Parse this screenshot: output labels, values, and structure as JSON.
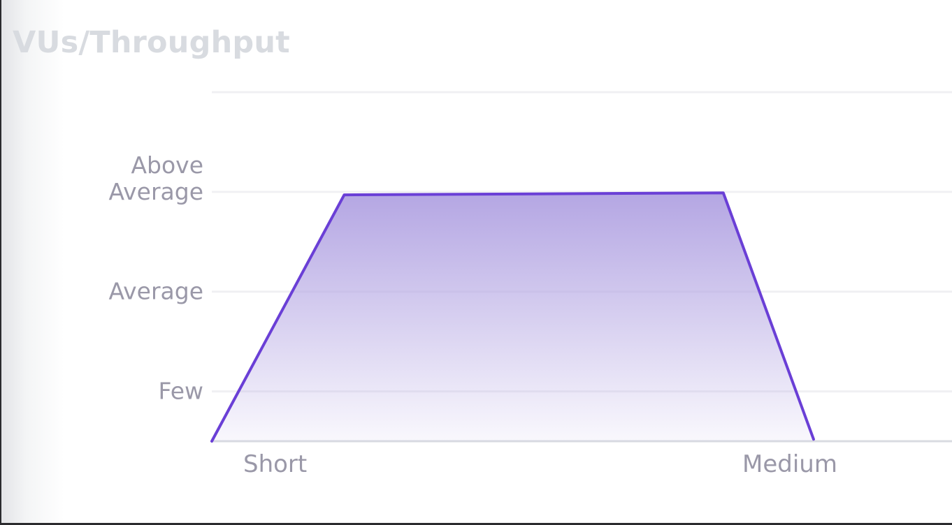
{
  "title": "VUs/Throughput",
  "colors": {
    "line": "#6a3fd6",
    "fill_top": "#b4a6e3",
    "grid": "#f0f0f3",
    "axis": "#d9dbe1",
    "tick_text": "#9a98a8",
    "title": "#d8dbe0"
  },
  "chart_data": {
    "type": "area",
    "title": "VUs/Throughput",
    "xlabel": "",
    "ylabel": "",
    "x_ticks": [
      "Short",
      "Medium"
    ],
    "y_ticks": [
      {
        "value": 1,
        "lines": [
          "Few"
        ]
      },
      {
        "value": 2,
        "lines": [
          "Average"
        ]
      },
      {
        "value": 3,
        "lines": [
          "Above",
          "Average"
        ]
      }
    ],
    "xlim": [
      0,
      1.23
    ],
    "ylim": [
      0.5,
      4
    ],
    "grid": true,
    "series": [
      {
        "x": [
          0,
          0.22,
          0.85,
          1.0
        ],
        "y": [
          0.5,
          2.97,
          2.99,
          0.52
        ]
      }
    ]
  }
}
